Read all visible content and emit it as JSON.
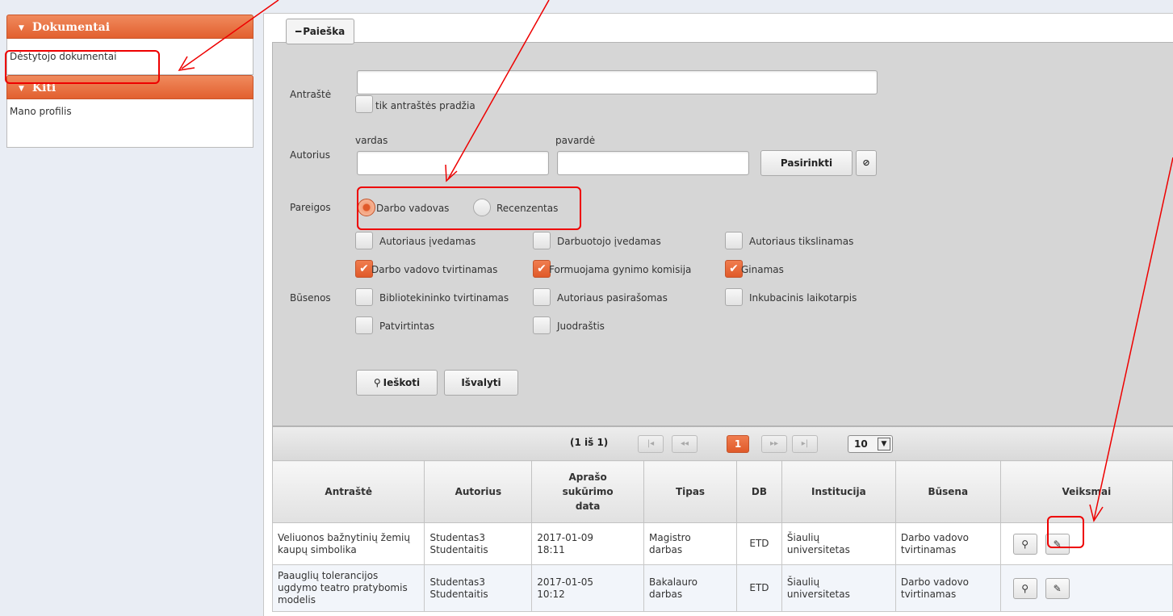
{
  "sidebar": {
    "dokumentai": {
      "title": "Dokumentai",
      "items": [
        "Dėstytojo dokumentai"
      ]
    },
    "kiti": {
      "title": "Kiti",
      "items": [
        "Mano profilis"
      ]
    }
  },
  "search": {
    "legend": "Paieška",
    "title_label": "Antraštė",
    "title_value": "",
    "prefix_only_label": "tik antraštės pradžia",
    "author_label": "Autorius",
    "first_name_label": "vardas",
    "last_name_label": "pavardė",
    "first_name_value": "",
    "last_name_value": "",
    "choose_button": "Pasirinkti",
    "clear_icon": "⊘",
    "role_label": "Pareigos",
    "roles": [
      "Darbo vadovas",
      "Recenzentas"
    ],
    "selected_role": "Darbo vadovas",
    "status_label": "Būsenos",
    "statuses": [
      {
        "label": "Autoriaus įvedamas",
        "checked": false
      },
      {
        "label": "Darbuotojo įvedamas",
        "checked": false
      },
      {
        "label": "Autoriaus tikslinamas",
        "checked": false
      },
      {
        "label": "Darbo vadovo tvirtinamas",
        "checked": true
      },
      {
        "label": "Formuojama gynimo komisija",
        "checked": true
      },
      {
        "label": "Ginamas",
        "checked": true
      },
      {
        "label": "Bibliotekininko tvirtinamas",
        "checked": false
      },
      {
        "label": "Autoriaus pasirašomas",
        "checked": false
      },
      {
        "label": "Inkubacinis laikotarpis",
        "checked": false
      },
      {
        "label": "Patvirtintas",
        "checked": false
      },
      {
        "label": "Juodraštis",
        "checked": false
      }
    ],
    "search_button": "Ieškoti",
    "reset_button": "Išvalyti"
  },
  "paginator": {
    "info": "(1 iš 1)",
    "first": "|◂",
    "prev": "◂◂",
    "current_page": "1",
    "next": "▸▸",
    "last": "▸|",
    "page_size": "10"
  },
  "table": {
    "headers": [
      "Antraštė",
      "Autorius",
      "Aprašo sukūrimo data",
      "Tipas",
      "DB",
      "Institucija",
      "Būsena",
      "Veiksmai"
    ],
    "rows": [
      {
        "title": "Veliuonos bažnytinių žemių kaupų simbolika",
        "author": "Studentas3 Studentaitis",
        "date": "2017-01-09 18:11",
        "type": "Magistro darbas",
        "db": "ETD",
        "institution": "Šiaulių universitetas",
        "status": "Darbo vadovo tvirtinamas"
      },
      {
        "title": "Paauglių tolerancijos ugdymo teatro pratybomis modelis",
        "author": "Studentas3 Studentaitis",
        "date": "2017-01-05 10:12",
        "type": "Bakalauro darbas",
        "db": "ETD",
        "institution": "Šiaulių universitetas",
        "status": "Darbo vadovo tvirtinamas"
      }
    ]
  },
  "icons": {
    "view": "magnifier-icon",
    "edit": "pencil-icon",
    "search": "magnifier-icon",
    "collapse": "minus-icon"
  },
  "colors": {
    "accent": "#e2602f",
    "annotation": "#ee0000",
    "panel": "#d6d6d6"
  }
}
